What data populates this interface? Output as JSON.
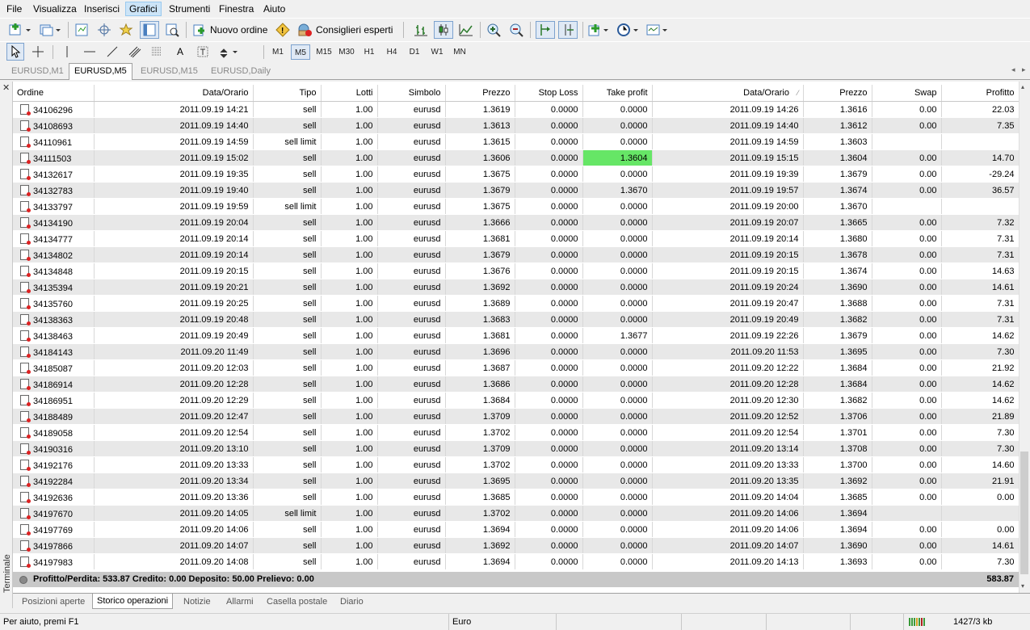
{
  "menu": [
    "File",
    "Visualizza",
    "Inserisci",
    "Grafici",
    "Strumenti",
    "Finestra",
    "Aiuto"
  ],
  "toolbar": {
    "new_order_label": "Nuovo ordine",
    "experts_label": "Consiglieri esperti"
  },
  "timeframes": [
    "M1",
    "M5",
    "M15",
    "M30",
    "H1",
    "H4",
    "D1",
    "W1",
    "MN"
  ],
  "chart_tabs": [
    "EURUSD,M1",
    "EURUSD,M5",
    "EURUSD,M15",
    "EURUSD,Daily"
  ],
  "terminal_label": "Terminale",
  "columns": [
    "Ordine",
    "Data/Orario",
    "Tipo",
    "Lotti",
    "Simbolo",
    "Prezzo",
    "Stop Loss",
    "Take profit",
    "Data/Orario",
    "Prezzo",
    "Swap",
    "Profitto"
  ],
  "rows": [
    [
      "34106296",
      "2011.09.19 14:21",
      "sell",
      "1.00",
      "eurusd",
      "1.3619",
      "0.0000",
      "0.0000",
      "2011.09.19 14:26",
      "1.3616",
      "0.00",
      "22.03"
    ],
    [
      "34108693",
      "2011.09.19 14:40",
      "sell",
      "1.00",
      "eurusd",
      "1.3613",
      "0.0000",
      "0.0000",
      "2011.09.19 14:40",
      "1.3612",
      "0.00",
      "7.35"
    ],
    [
      "34110961",
      "2011.09.19 14:59",
      "sell limit",
      "1.00",
      "eurusd",
      "1.3615",
      "0.0000",
      "0.0000",
      "2011.09.19 14:59",
      "1.3603",
      "",
      ""
    ],
    [
      "34111503",
      "2011.09.19 15:02",
      "sell",
      "1.00",
      "eurusd",
      "1.3606",
      "0.0000",
      "1.3604",
      "2011.09.19 15:15",
      "1.3604",
      "0.00",
      "14.70"
    ],
    [
      "34132617",
      "2011.09.19 19:35",
      "sell",
      "1.00",
      "eurusd",
      "1.3675",
      "0.0000",
      "0.0000",
      "2011.09.19 19:39",
      "1.3679",
      "0.00",
      "-29.24"
    ],
    [
      "34132783",
      "2011.09.19 19:40",
      "sell",
      "1.00",
      "eurusd",
      "1.3679",
      "0.0000",
      "1.3670",
      "2011.09.19 19:57",
      "1.3674",
      "0.00",
      "36.57"
    ],
    [
      "34133797",
      "2011.09.19 19:59",
      "sell limit",
      "1.00",
      "eurusd",
      "1.3675",
      "0.0000",
      "0.0000",
      "2011.09.19 20:00",
      "1.3670",
      "",
      ""
    ],
    [
      "34134190",
      "2011.09.19 20:04",
      "sell",
      "1.00",
      "eurusd",
      "1.3666",
      "0.0000",
      "0.0000",
      "2011.09.19 20:07",
      "1.3665",
      "0.00",
      "7.32"
    ],
    [
      "34134777",
      "2011.09.19 20:14",
      "sell",
      "1.00",
      "eurusd",
      "1.3681",
      "0.0000",
      "0.0000",
      "2011.09.19 20:14",
      "1.3680",
      "0.00",
      "7.31"
    ],
    [
      "34134802",
      "2011.09.19 20:14",
      "sell",
      "1.00",
      "eurusd",
      "1.3679",
      "0.0000",
      "0.0000",
      "2011.09.19 20:15",
      "1.3678",
      "0.00",
      "7.31"
    ],
    [
      "34134848",
      "2011.09.19 20:15",
      "sell",
      "1.00",
      "eurusd",
      "1.3676",
      "0.0000",
      "0.0000",
      "2011.09.19 20:15",
      "1.3674",
      "0.00",
      "14.63"
    ],
    [
      "34135394",
      "2011.09.19 20:21",
      "sell",
      "1.00",
      "eurusd",
      "1.3692",
      "0.0000",
      "0.0000",
      "2011.09.19 20:24",
      "1.3690",
      "0.00",
      "14.61"
    ],
    [
      "34135760",
      "2011.09.19 20:25",
      "sell",
      "1.00",
      "eurusd",
      "1.3689",
      "0.0000",
      "0.0000",
      "2011.09.19 20:47",
      "1.3688",
      "0.00",
      "7.31"
    ],
    [
      "34138363",
      "2011.09.19 20:48",
      "sell",
      "1.00",
      "eurusd",
      "1.3683",
      "0.0000",
      "0.0000",
      "2011.09.19 20:49",
      "1.3682",
      "0.00",
      "7.31"
    ],
    [
      "34138463",
      "2011.09.19 20:49",
      "sell",
      "1.00",
      "eurusd",
      "1.3681",
      "0.0000",
      "1.3677",
      "2011.09.19 22:26",
      "1.3679",
      "0.00",
      "14.62"
    ],
    [
      "34184143",
      "2011.09.20 11:49",
      "sell",
      "1.00",
      "eurusd",
      "1.3696",
      "0.0000",
      "0.0000",
      "2011.09.20 11:53",
      "1.3695",
      "0.00",
      "7.30"
    ],
    [
      "34185087",
      "2011.09.20 12:03",
      "sell",
      "1.00",
      "eurusd",
      "1.3687",
      "0.0000",
      "0.0000",
      "2011.09.20 12:22",
      "1.3684",
      "0.00",
      "21.92"
    ],
    [
      "34186914",
      "2011.09.20 12:28",
      "sell",
      "1.00",
      "eurusd",
      "1.3686",
      "0.0000",
      "0.0000",
      "2011.09.20 12:28",
      "1.3684",
      "0.00",
      "14.62"
    ],
    [
      "34186951",
      "2011.09.20 12:29",
      "sell",
      "1.00",
      "eurusd",
      "1.3684",
      "0.0000",
      "0.0000",
      "2011.09.20 12:30",
      "1.3682",
      "0.00",
      "14.62"
    ],
    [
      "34188489",
      "2011.09.20 12:47",
      "sell",
      "1.00",
      "eurusd",
      "1.3709",
      "0.0000",
      "0.0000",
      "2011.09.20 12:52",
      "1.3706",
      "0.00",
      "21.89"
    ],
    [
      "34189058",
      "2011.09.20 12:54",
      "sell",
      "1.00",
      "eurusd",
      "1.3702",
      "0.0000",
      "0.0000",
      "2011.09.20 12:54",
      "1.3701",
      "0.00",
      "7.30"
    ],
    [
      "34190316",
      "2011.09.20 13:10",
      "sell",
      "1.00",
      "eurusd",
      "1.3709",
      "0.0000",
      "0.0000",
      "2011.09.20 13:14",
      "1.3708",
      "0.00",
      "7.30"
    ],
    [
      "34192176",
      "2011.09.20 13:33",
      "sell",
      "1.00",
      "eurusd",
      "1.3702",
      "0.0000",
      "0.0000",
      "2011.09.20 13:33",
      "1.3700",
      "0.00",
      "14.60"
    ],
    [
      "34192284",
      "2011.09.20 13:34",
      "sell",
      "1.00",
      "eurusd",
      "1.3695",
      "0.0000",
      "0.0000",
      "2011.09.20 13:35",
      "1.3692",
      "0.00",
      "21.91"
    ],
    [
      "34192636",
      "2011.09.20 13:36",
      "sell",
      "1.00",
      "eurusd",
      "1.3685",
      "0.0000",
      "0.0000",
      "2011.09.20 14:04",
      "1.3685",
      "0.00",
      "0.00"
    ],
    [
      "34197670",
      "2011.09.20 14:05",
      "sell limit",
      "1.00",
      "eurusd",
      "1.3702",
      "0.0000",
      "0.0000",
      "2011.09.20 14:06",
      "1.3694",
      "",
      ""
    ],
    [
      "34197769",
      "2011.09.20 14:06",
      "sell",
      "1.00",
      "eurusd",
      "1.3694",
      "0.0000",
      "0.0000",
      "2011.09.20 14:06",
      "1.3694",
      "0.00",
      "0.00"
    ],
    [
      "34197866",
      "2011.09.20 14:07",
      "sell",
      "1.00",
      "eurusd",
      "1.3692",
      "0.0000",
      "0.0000",
      "2011.09.20 14:07",
      "1.3690",
      "0.00",
      "14.61"
    ],
    [
      "34197983",
      "2011.09.20 14:08",
      "sell",
      "1.00",
      "eurusd",
      "1.3694",
      "0.0000",
      "0.0000",
      "2011.09.20 14:13",
      "1.3693",
      "0.00",
      "7.30"
    ]
  ],
  "summary": {
    "text": "Profitto/Perdita: 533.87  Credito: 0.00  Deposito: 50.00  Prelievo: 0.00",
    "total": "583.87"
  },
  "bottom_tabs": [
    "Posizioni aperte",
    "Storico operazioni",
    "Notizie",
    "Allarmi",
    "Casella postale",
    "Diario"
  ],
  "status": {
    "help": "Per aiuto, premi F1",
    "profile": "Euro",
    "traffic": "1427/3 kb"
  },
  "colors": {
    "highlight": "#66e666",
    "active_menu": "#cce4f7"
  }
}
